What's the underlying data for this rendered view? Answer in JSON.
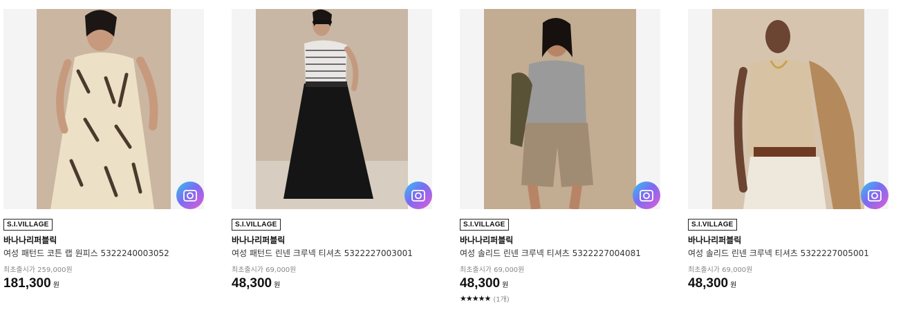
{
  "products": [
    {
      "badge": "S.I.VILLAGE",
      "brand": "바나나리퍼블릭",
      "name": "여성 패턴드 코튼 랩 원피스 5322240003052",
      "original_label": "최초출시가 259,000원",
      "price": "181,300",
      "currency": "원",
      "image": {
        "subject": "woman in printed wrap dress",
        "bg": "#cbb6a1",
        "outfit": "#ece0c6"
      }
    },
    {
      "badge": "S.I.VILLAGE",
      "brand": "바나나리퍼블릭",
      "name": "여성 패턴드 린넨 크루넥 티셔츠 5322227003001",
      "original_label": "최초출시가 69,000원",
      "price": "48,300",
      "currency": "원",
      "image": {
        "subject": "woman in striped tee and black wide pants",
        "bg": "#c8b7a4",
        "outfit": "#151515"
      }
    },
    {
      "badge": "S.I.VILLAGE",
      "brand": "바나나리퍼블릭",
      "name": "여성 솔리드 린넨 크루넥 티셔츠 5322227004081",
      "original_label": "최초출시가 69,000원",
      "price": "48,300",
      "currency": "원",
      "rating": {
        "stars": "★★★★★",
        "count": "(1개)"
      },
      "image": {
        "subject": "woman in grey tee and khaki shorts",
        "bg": "#c2ac92",
        "outfit": "#9a9a9a"
      }
    },
    {
      "badge": "S.I.VILLAGE",
      "brand": "바나나리퍼블릭",
      "name": "여성 솔리드 린넨 크루넥 티셔츠 5322227005001",
      "original_label": "최초출시가 69,000원",
      "price": "48,300",
      "currency": "원",
      "image": {
        "subject": "woman in beige tee and white pants",
        "bg": "#d6c4ae",
        "outfit": "#d8c2a4"
      }
    }
  ]
}
